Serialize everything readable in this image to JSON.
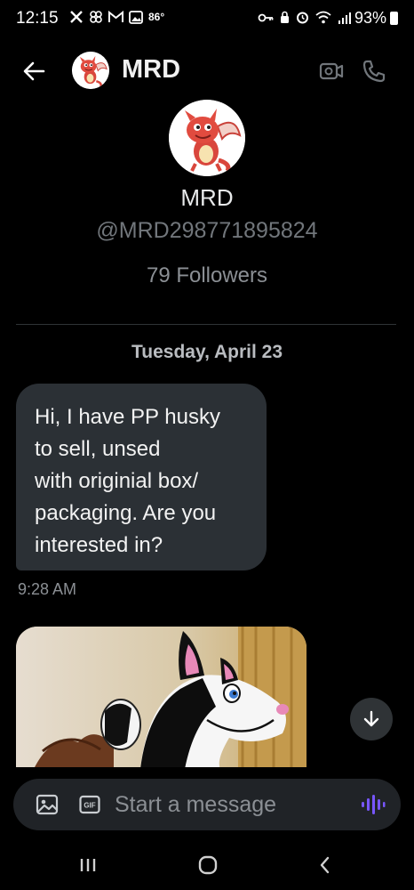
{
  "status_bar": {
    "time": "12:15",
    "temperature": "86°",
    "battery": "93%"
  },
  "header": {
    "name": "MRD",
    "icons": [
      "back-arrow-icon",
      "video-icon",
      "phone-icon"
    ]
  },
  "profile": {
    "name": "MRD",
    "handle": "@MRD298771895824",
    "followers": "79 Followers"
  },
  "conversation": {
    "date_separator": "Tuesday, April 23",
    "messages": [
      {
        "text": "Hi, I have PP husky\nto sell, unsed\nwith originial box/\npackaging.  Are you\ninterested in?",
        "time": "9:28 AM"
      }
    ]
  },
  "composer": {
    "placeholder": "Start a message",
    "icons": [
      "image-icon",
      "gif-icon",
      "voice-icon"
    ]
  },
  "colors": {
    "background": "#000000",
    "bubble": "#2b3035",
    "composer": "#202327",
    "muted_text": "#71767b",
    "accent_voice": "#7856ff"
  }
}
